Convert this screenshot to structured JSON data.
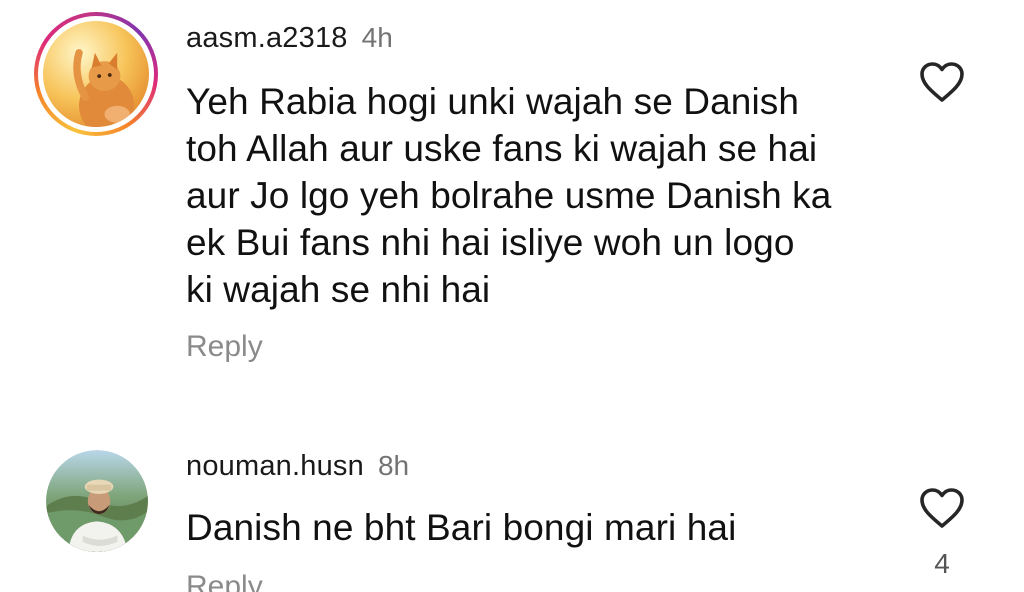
{
  "comments": [
    {
      "username": "aasm.a2318",
      "time": "4h",
      "text_lines": [
        "Yeh Rabia hogi unki wajah se Danish",
        "toh Allah aur uske fans ki wajah se hai",
        "aur Jo lgo yeh bolrahe usme Danish ka",
        "ek Bui fans nhi hai isliye woh un logo",
        "ki wajah se nhi hai"
      ],
      "reply_label": "Reply",
      "avatar_icon": "cat-photo-avatar",
      "like_icon": "heart-outline-icon"
    },
    {
      "username": "nouman.husn",
      "time": "8h",
      "text_lines": [
        "Danish ne bht Bari bongi mari hai"
      ],
      "reply_label": "Reply",
      "like_count": "4",
      "avatar_icon": "person-photo-avatar",
      "like_icon": "heart-outline-icon"
    }
  ],
  "colors": {
    "text": "#111111",
    "muted": "#737373",
    "reply": "#8a8a8a",
    "story_ring": [
      "#f9c23c",
      "#f58529",
      "#dd2a7b",
      "#8134af"
    ]
  }
}
